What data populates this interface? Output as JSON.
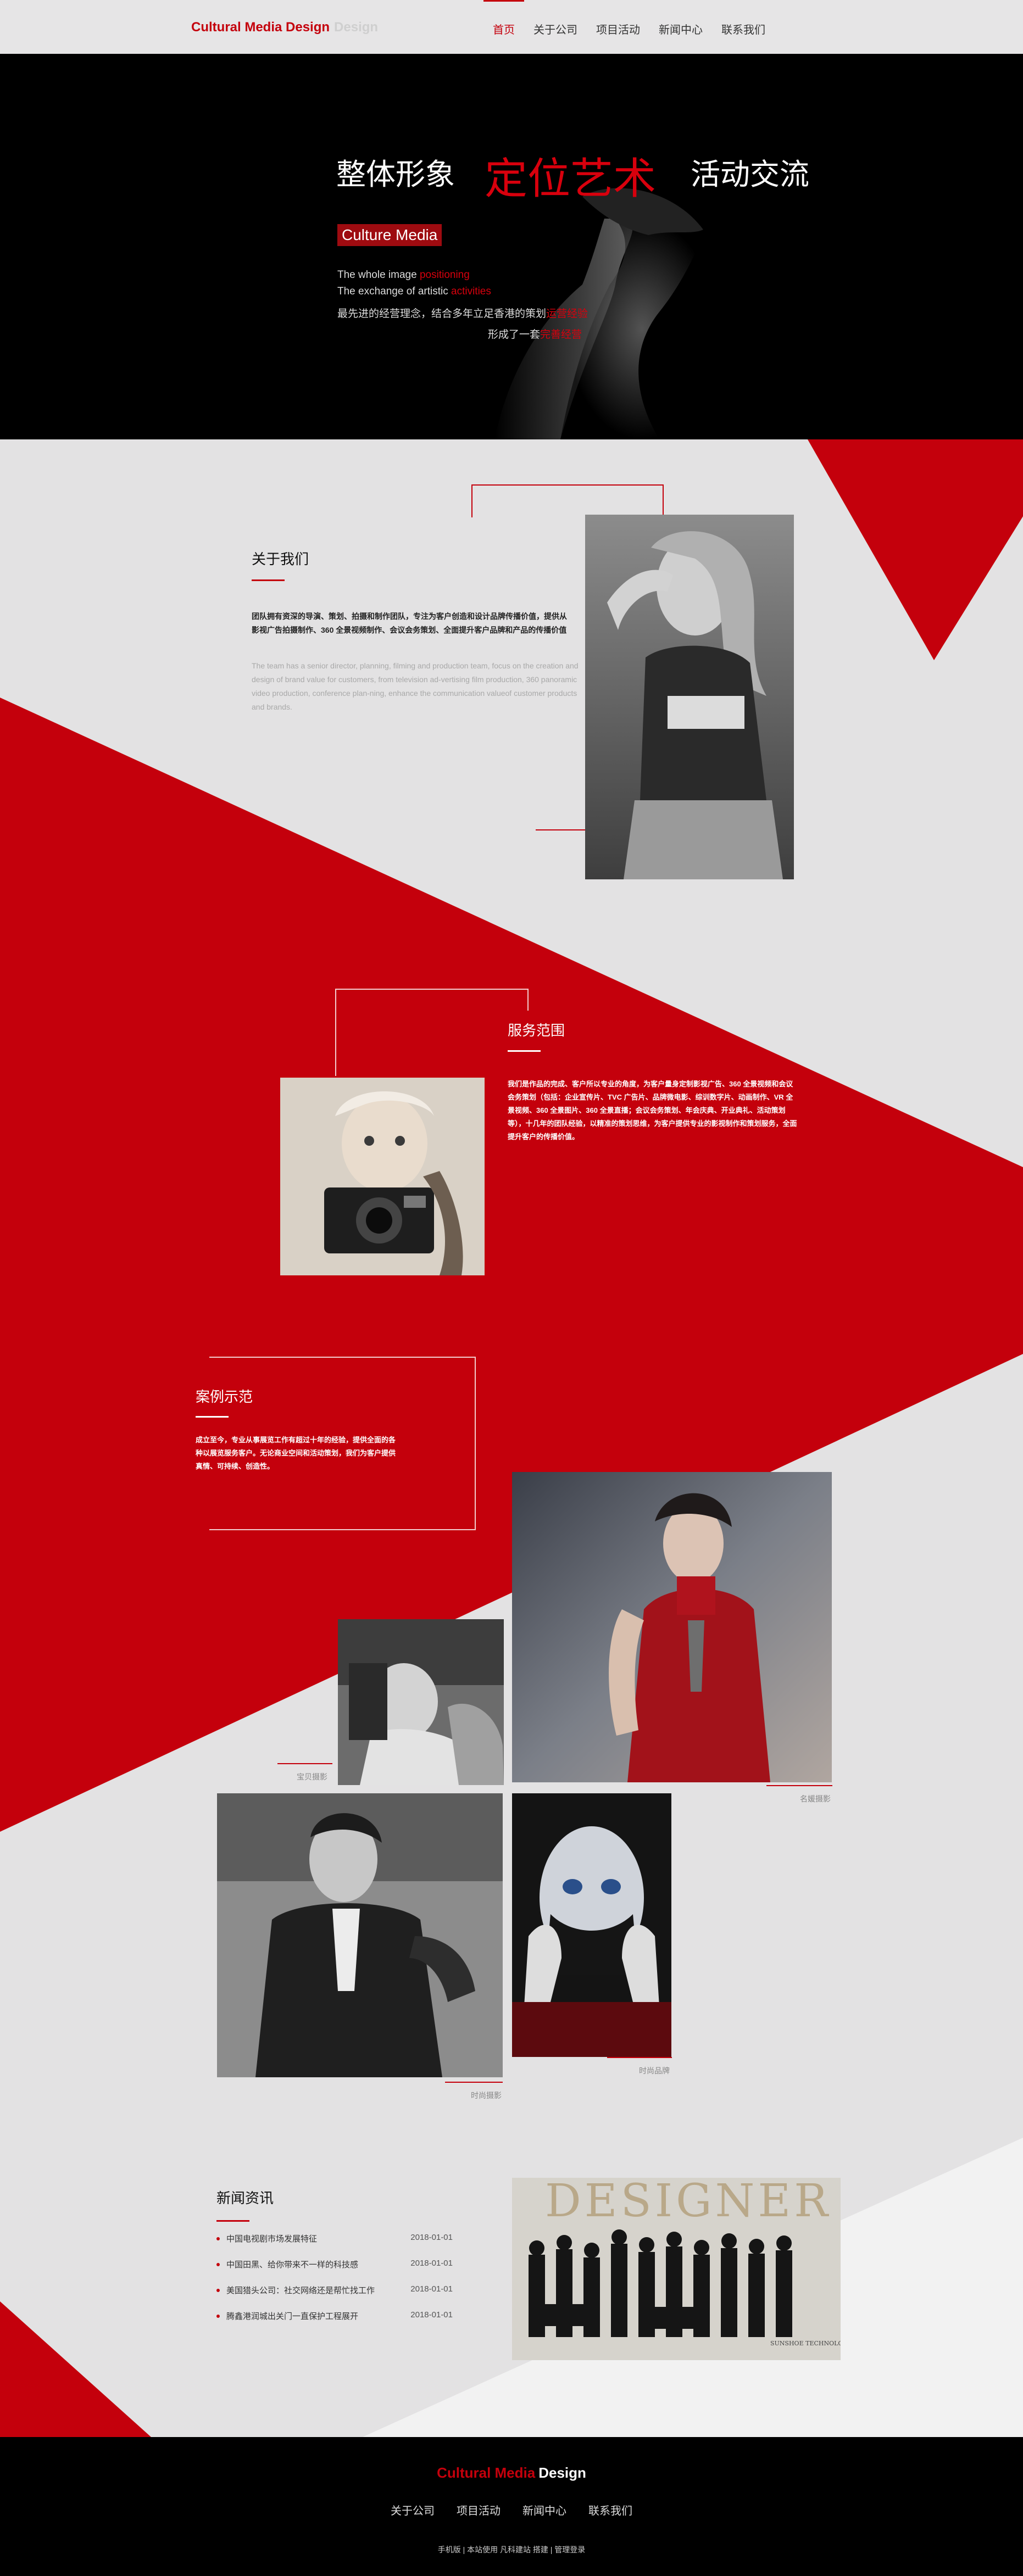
{
  "header": {
    "logo_primary": "Cultural Media Design",
    "logo_secondary": "Design",
    "nav": [
      "首页",
      "关于公司",
      "项目活动",
      "新闻中心",
      "联系我们"
    ]
  },
  "hero": {
    "title_left": "整体形象",
    "title_center": "定位艺术",
    "title_right": "活动交流",
    "badge": "Culture Media",
    "line1_a": "The whole image ",
    "line1_b": "positioning",
    "line2_a": "The exchange of artistic ",
    "line2_b": "activities",
    "line3_a": "最先进的经营理念，结合多年立足香港的策划",
    "line3_b": "运营经验",
    "line4_a": "形成了一套",
    "line4_b": "完善经营"
  },
  "about": {
    "title": "关于我们",
    "text_zh": "团队拥有资深的导演、策划、拍摄和制作团队，专注为客户创造和设计品牌传播价值，提供从影视广告拍摄制作、360 全景视频制作、会议会务策划、全面提升客户品牌和产品的传播价值",
    "text_en": "The team has a senior director, planning, filming and production team, focus on the creation and design of brand value for customers, from television ad-vertising film production, 360 panoramic video production, conference plan-ning, enhance the communication valueof customer products and brands."
  },
  "service": {
    "title": "服务范围",
    "text": "我们是作品的完成、客户所以专业的角度，为客户量身定制影视广告、360 全景视频和会议会务策划（包括：企业宣传片、TVC 广告片、品牌微电影、综训数字片、动画制作、VR 全景视频、360 全景图片、360 全景直播；会议会务策划、年会庆典、开业典礼、活动策划等），十几年的团队经验，以精准的策划思维，为客户提供专业的影视制作和策划服务，全面提升客户的传播价值。"
  },
  "cases": {
    "title": "案例示范",
    "text": "成立至今，专业从事展览工作有超过十年的经验，提供全面的各种以展览服务客户。无论商业空间和活动策划，我们为客户提供真情、可持续、创造性。",
    "captions": [
      "宝贝摄影",
      "名媛摄影",
      "时尚摄影",
      "时尚品牌"
    ]
  },
  "news": {
    "title": "新闻资讯",
    "items": [
      {
        "title": "中国电视剧市场发展特征",
        "date": "2018-01-01"
      },
      {
        "title": "中国田黑、给你带来不一样的科技感",
        "date": "2018-01-01"
      },
      {
        "title": "美国猎头公司：社交网络还是帮忙找工作",
        "date": "2018-01-01"
      },
      {
        "title": "腾鑫港润城出关门一直保护工程展开",
        "date": "2018-01-01"
      }
    ],
    "image_text": "DESIGNER",
    "image_subtext": "SUNSHOE TECHNOLOGY"
  },
  "footer": {
    "logo_primary": "Cultural Media",
    "logo_secondary": "Design",
    "nav": [
      "关于公司",
      "项目活动",
      "新闻中心",
      "联系我们"
    ],
    "links": "手机版 | 本站使用 凡科建站 搭建 | 管理登录"
  },
  "colors": {
    "accent": "#c4000c",
    "dark": "#000000",
    "bg": "#e3e2e3"
  }
}
